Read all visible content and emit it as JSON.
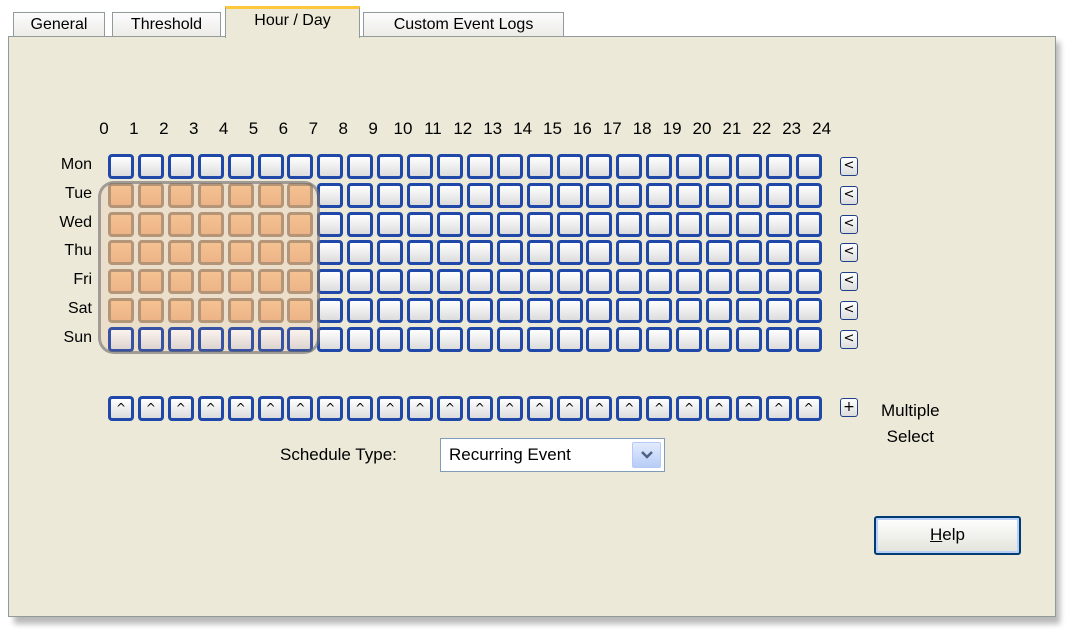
{
  "tabs": [
    {
      "label": "General",
      "active": false
    },
    {
      "label": "Threshold",
      "active": false
    },
    {
      "label": "Hour / Day",
      "active": true
    },
    {
      "label": "Custom Event Logs",
      "active": false
    }
  ],
  "hours": [
    "0",
    "1",
    "2",
    "3",
    "4",
    "5",
    "6",
    "7",
    "8",
    "9",
    "10",
    "11",
    "12",
    "13",
    "14",
    "15",
    "16",
    "17",
    "18",
    "19",
    "20",
    "21",
    "22",
    "23",
    "24"
  ],
  "days": [
    "Mon",
    "Tue",
    "Wed",
    "Thu",
    "Fri",
    "Sat",
    "Sun"
  ],
  "selected_cells": {
    "days": [
      "Tue",
      "Wed",
      "Thu",
      "Fri",
      "Sat"
    ],
    "hours": [
      "0-1",
      "1-2",
      "2-3",
      "3-4",
      "4-5",
      "5-6",
      "6-7"
    ]
  },
  "row_button_symbol": "<",
  "column_button_symbol": "^",
  "multiple_select": {
    "button_symbol": "+",
    "label_line1": "Multiple",
    "label_line2": "Select"
  },
  "schedule": {
    "label": "Schedule Type:",
    "value": "Recurring Event"
  },
  "help_button": {
    "mnemonic": "H",
    "rest": "elp"
  },
  "colors": {
    "panel": "#ece9d8",
    "cell_border": "#1f48a8",
    "selected_fill": "#f4c08f",
    "active_tab_accent": "#ffc83c"
  },
  "icons": [
    "chevron-down-icon"
  ]
}
